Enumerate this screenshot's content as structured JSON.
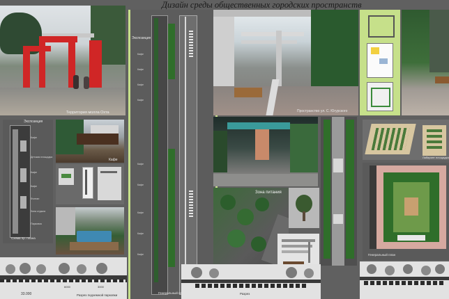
{
  "board": {
    "title": "Дизайн среды общественных городских пространств"
  },
  "photos": {
    "mall_territory": "Территория молла Охта",
    "street_space": "Пространство ул. С. Югурского",
    "food_zone": "Зона питания",
    "cafe": "Кафе",
    "children_playground": "Лабиринт площадка",
    "general_plan_right": "Генеральный план",
    "general_plan_mid": "Генеральный план"
  },
  "plan_left": {
    "exposition": "Экспозиция",
    "labels": [
      "Кафе",
      "Детская площадка",
      "Кафе",
      "Кафе",
      "Фонтан",
      "Зона отдыха",
      "Парковка"
    ],
    "scheme": "Схема пр. плана"
  },
  "plan_mid": {
    "exposition": "Экспозиция",
    "labels": [
      "Кафе",
      "Кафе",
      "Кафе",
      "Кафе",
      "Кафе",
      "Кафе",
      "Кафе",
      "Кафе",
      "Кафе"
    ]
  },
  "sections": {
    "left_dims": [
      "33.000",
      "6000",
      "3000"
    ],
    "left_caption": "Разрез подземной парковки",
    "mid_caption": "Разрез"
  },
  "colors": {
    "background": "#606060",
    "accent_border": "#c6e08a",
    "pavilion_red": "#d02626",
    "greenery": "#2f6e2a"
  }
}
